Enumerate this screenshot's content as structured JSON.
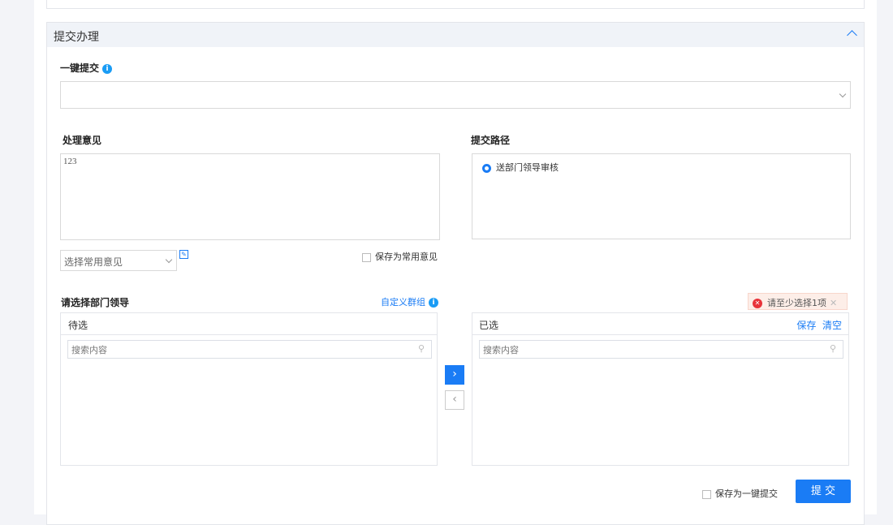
{
  "section_title": "提交办理",
  "quick_submit": {
    "label": "一键提交",
    "value": ""
  },
  "opinion": {
    "label": "处理意见",
    "value": "123",
    "common_select_placeholder": "选择常用意见",
    "save_common_label": "保存为常用意见"
  },
  "path": {
    "label": "提交路径",
    "options": [
      {
        "label": "送部门领导审核",
        "selected": true
      }
    ]
  },
  "leader": {
    "label": "请选择部门领导",
    "custom_group": "自定义群组",
    "pending": {
      "title": "待选",
      "search_placeholder": "搜索内容"
    },
    "selected": {
      "title": "已选",
      "save": "保存",
      "clear": "清空",
      "search_placeholder": "搜索内容"
    },
    "error": "请至少选择1项"
  },
  "footer": {
    "save_quick_label": "保存为一键提交",
    "submit": "提 交"
  },
  "colors": {
    "accent": "#1a7cf5",
    "error": "#e8333a"
  }
}
